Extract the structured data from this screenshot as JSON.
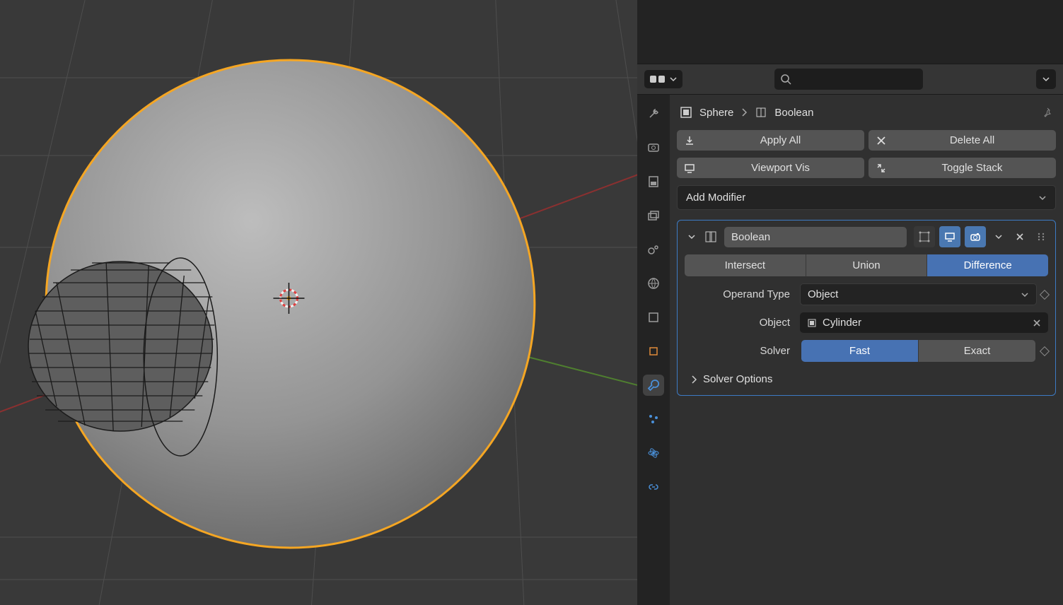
{
  "breadcrumb": {
    "object": "Sphere",
    "modifier": "Boolean"
  },
  "buttons": {
    "apply_all": "Apply All",
    "delete_all": "Delete All",
    "viewport_vis": "Viewport Vis",
    "toggle_stack": "Toggle Stack",
    "add_modifier": "Add Modifier"
  },
  "modifier": {
    "name": "Boolean",
    "operation": {
      "options": [
        "Intersect",
        "Union",
        "Difference"
      ],
      "active": "Difference"
    },
    "operand_type": {
      "label": "Operand Type",
      "value": "Object"
    },
    "object": {
      "label": "Object",
      "value": "Cylinder"
    },
    "solver": {
      "label": "Solver",
      "options": [
        "Fast",
        "Exact"
      ],
      "active": "Fast"
    },
    "solver_options_label": "Solver Options"
  },
  "search_placeholder": ""
}
